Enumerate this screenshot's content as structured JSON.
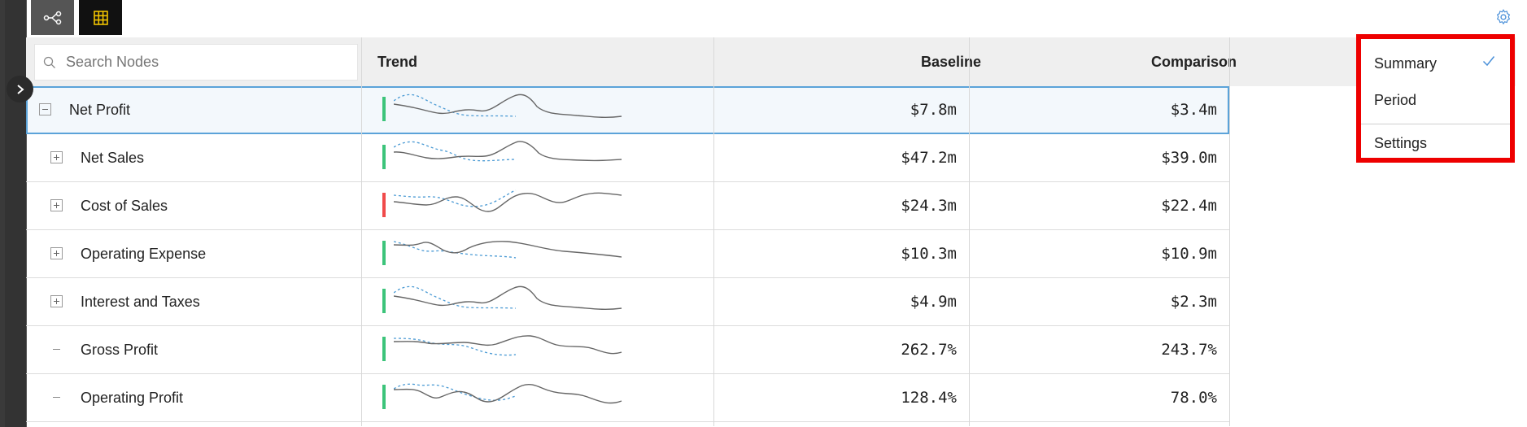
{
  "toolbar": {
    "tree_icon": "tree-view-icon",
    "grid_icon": "grid-view-icon",
    "settings_icon": "gear-icon"
  },
  "search": {
    "placeholder": "Search Nodes",
    "value": ""
  },
  "columns": {
    "trend": "Trend",
    "baseline": "Baseline",
    "comparison": "Comparison"
  },
  "rows": [
    {
      "name": "Net Profit",
      "baseline": "$7.8m",
      "comparison": "$3.4m",
      "toggle": "collapse",
      "indicator": "#3cc47a"
    },
    {
      "name": "Net Sales",
      "baseline": "$47.2m",
      "comparison": "$39.0m",
      "toggle": "expand",
      "indicator": "#3cc47a"
    },
    {
      "name": "Cost of Sales",
      "baseline": "$24.3m",
      "comparison": "$22.4m",
      "toggle": "expand",
      "indicator": "#f04a4a"
    },
    {
      "name": "Operating Expense",
      "baseline": "$10.3m",
      "comparison": "$10.9m",
      "toggle": "expand",
      "indicator": "#3cc47a"
    },
    {
      "name": "Interest and Taxes",
      "baseline": "$4.9m",
      "comparison": "$2.3m",
      "toggle": "expand",
      "indicator": "#3cc47a"
    },
    {
      "name": "Gross Profit",
      "baseline": "262.7%",
      "comparison": "243.7%",
      "toggle": "none",
      "indicator": "#3cc47a"
    },
    {
      "name": "Operating Profit",
      "baseline": "128.4%",
      "comparison": "78.0%",
      "toggle": "none",
      "indicator": "#3cc47a"
    }
  ],
  "menu": {
    "items": [
      "Summary",
      "Period",
      "Settings"
    ],
    "checked": "Summary"
  },
  "colors": {
    "selected_border": "#5ba3d9",
    "menu_highlight": "#ee0000",
    "check": "#4a90d9"
  }
}
